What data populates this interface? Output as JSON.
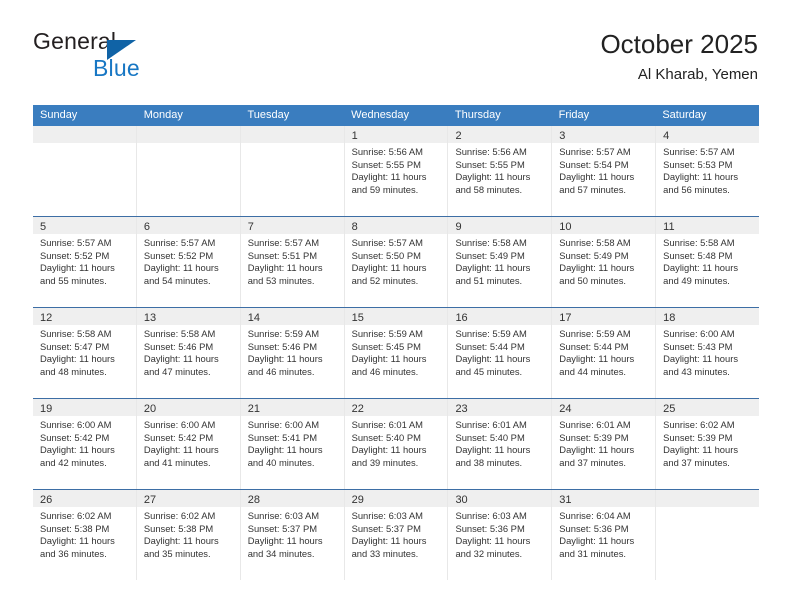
{
  "brand": {
    "word1": "General",
    "word2": "Blue",
    "triangle_color": "#1063a6",
    "blue_color": "#1877c4"
  },
  "header": {
    "title": "October 2025",
    "subtitle": "Al Kharab, Yemen"
  },
  "theme": {
    "header_row_bg": "#3a7dbf",
    "week_divider": "#3d6ea5",
    "daynum_bar_bg": "#efefef",
    "text": "#333333"
  },
  "weekdays": [
    "Sunday",
    "Monday",
    "Tuesday",
    "Wednesday",
    "Thursday",
    "Friday",
    "Saturday"
  ],
  "labels": {
    "sunrise_prefix": "Sunrise:",
    "sunset_prefix": "Sunset:",
    "daylight_prefix": "Daylight:"
  },
  "weeks": [
    [
      {
        "day": "",
        "empty": true
      },
      {
        "day": "",
        "empty": true
      },
      {
        "day": "",
        "empty": true
      },
      {
        "day": "1",
        "line1": "Sunrise: 5:56 AM",
        "line2": "Sunset: 5:55 PM",
        "line3": "Daylight: 11 hours and 59 minutes."
      },
      {
        "day": "2",
        "line1": "Sunrise: 5:56 AM",
        "line2": "Sunset: 5:55 PM",
        "line3": "Daylight: 11 hours and 58 minutes."
      },
      {
        "day": "3",
        "line1": "Sunrise: 5:57 AM",
        "line2": "Sunset: 5:54 PM",
        "line3": "Daylight: 11 hours and 57 minutes."
      },
      {
        "day": "4",
        "line1": "Sunrise: 5:57 AM",
        "line2": "Sunset: 5:53 PM",
        "line3": "Daylight: 11 hours and 56 minutes."
      }
    ],
    [
      {
        "day": "5",
        "line1": "Sunrise: 5:57 AM",
        "line2": "Sunset: 5:52 PM",
        "line3": "Daylight: 11 hours and 55 minutes."
      },
      {
        "day": "6",
        "line1": "Sunrise: 5:57 AM",
        "line2": "Sunset: 5:52 PM",
        "line3": "Daylight: 11 hours and 54 minutes."
      },
      {
        "day": "7",
        "line1": "Sunrise: 5:57 AM",
        "line2": "Sunset: 5:51 PM",
        "line3": "Daylight: 11 hours and 53 minutes."
      },
      {
        "day": "8",
        "line1": "Sunrise: 5:57 AM",
        "line2": "Sunset: 5:50 PM",
        "line3": "Daylight: 11 hours and 52 minutes."
      },
      {
        "day": "9",
        "line1": "Sunrise: 5:58 AM",
        "line2": "Sunset: 5:49 PM",
        "line3": "Daylight: 11 hours and 51 minutes."
      },
      {
        "day": "10",
        "line1": "Sunrise: 5:58 AM",
        "line2": "Sunset: 5:49 PM",
        "line3": "Daylight: 11 hours and 50 minutes."
      },
      {
        "day": "11",
        "line1": "Sunrise: 5:58 AM",
        "line2": "Sunset: 5:48 PM",
        "line3": "Daylight: 11 hours and 49 minutes."
      }
    ],
    [
      {
        "day": "12",
        "line1": "Sunrise: 5:58 AM",
        "line2": "Sunset: 5:47 PM",
        "line3": "Daylight: 11 hours and 48 minutes."
      },
      {
        "day": "13",
        "line1": "Sunrise: 5:58 AM",
        "line2": "Sunset: 5:46 PM",
        "line3": "Daylight: 11 hours and 47 minutes."
      },
      {
        "day": "14",
        "line1": "Sunrise: 5:59 AM",
        "line2": "Sunset: 5:46 PM",
        "line3": "Daylight: 11 hours and 46 minutes."
      },
      {
        "day": "15",
        "line1": "Sunrise: 5:59 AM",
        "line2": "Sunset: 5:45 PM",
        "line3": "Daylight: 11 hours and 46 minutes."
      },
      {
        "day": "16",
        "line1": "Sunrise: 5:59 AM",
        "line2": "Sunset: 5:44 PM",
        "line3": "Daylight: 11 hours and 45 minutes."
      },
      {
        "day": "17",
        "line1": "Sunrise: 5:59 AM",
        "line2": "Sunset: 5:44 PM",
        "line3": "Daylight: 11 hours and 44 minutes."
      },
      {
        "day": "18",
        "line1": "Sunrise: 6:00 AM",
        "line2": "Sunset: 5:43 PM",
        "line3": "Daylight: 11 hours and 43 minutes."
      }
    ],
    [
      {
        "day": "19",
        "line1": "Sunrise: 6:00 AM",
        "line2": "Sunset: 5:42 PM",
        "line3": "Daylight: 11 hours and 42 minutes."
      },
      {
        "day": "20",
        "line1": "Sunrise: 6:00 AM",
        "line2": "Sunset: 5:42 PM",
        "line3": "Daylight: 11 hours and 41 minutes."
      },
      {
        "day": "21",
        "line1": "Sunrise: 6:00 AM",
        "line2": "Sunset: 5:41 PM",
        "line3": "Daylight: 11 hours and 40 minutes."
      },
      {
        "day": "22",
        "line1": "Sunrise: 6:01 AM",
        "line2": "Sunset: 5:40 PM",
        "line3": "Daylight: 11 hours and 39 minutes."
      },
      {
        "day": "23",
        "line1": "Sunrise: 6:01 AM",
        "line2": "Sunset: 5:40 PM",
        "line3": "Daylight: 11 hours and 38 minutes."
      },
      {
        "day": "24",
        "line1": "Sunrise: 6:01 AM",
        "line2": "Sunset: 5:39 PM",
        "line3": "Daylight: 11 hours and 37 minutes."
      },
      {
        "day": "25",
        "line1": "Sunrise: 6:02 AM",
        "line2": "Sunset: 5:39 PM",
        "line3": "Daylight: 11 hours and 37 minutes."
      }
    ],
    [
      {
        "day": "26",
        "line1": "Sunrise: 6:02 AM",
        "line2": "Sunset: 5:38 PM",
        "line3": "Daylight: 11 hours and 36 minutes."
      },
      {
        "day": "27",
        "line1": "Sunrise: 6:02 AM",
        "line2": "Sunset: 5:38 PM",
        "line3": "Daylight: 11 hours and 35 minutes."
      },
      {
        "day": "28",
        "line1": "Sunrise: 6:03 AM",
        "line2": "Sunset: 5:37 PM",
        "line3": "Daylight: 11 hours and 34 minutes."
      },
      {
        "day": "29",
        "line1": "Sunrise: 6:03 AM",
        "line2": "Sunset: 5:37 PM",
        "line3": "Daylight: 11 hours and 33 minutes."
      },
      {
        "day": "30",
        "line1": "Sunrise: 6:03 AM",
        "line2": "Sunset: 5:36 PM",
        "line3": "Daylight: 11 hours and 32 minutes."
      },
      {
        "day": "31",
        "line1": "Sunrise: 6:04 AM",
        "line2": "Sunset: 5:36 PM",
        "line3": "Daylight: 11 hours and 31 minutes."
      },
      {
        "day": "",
        "empty": true
      }
    ]
  ]
}
